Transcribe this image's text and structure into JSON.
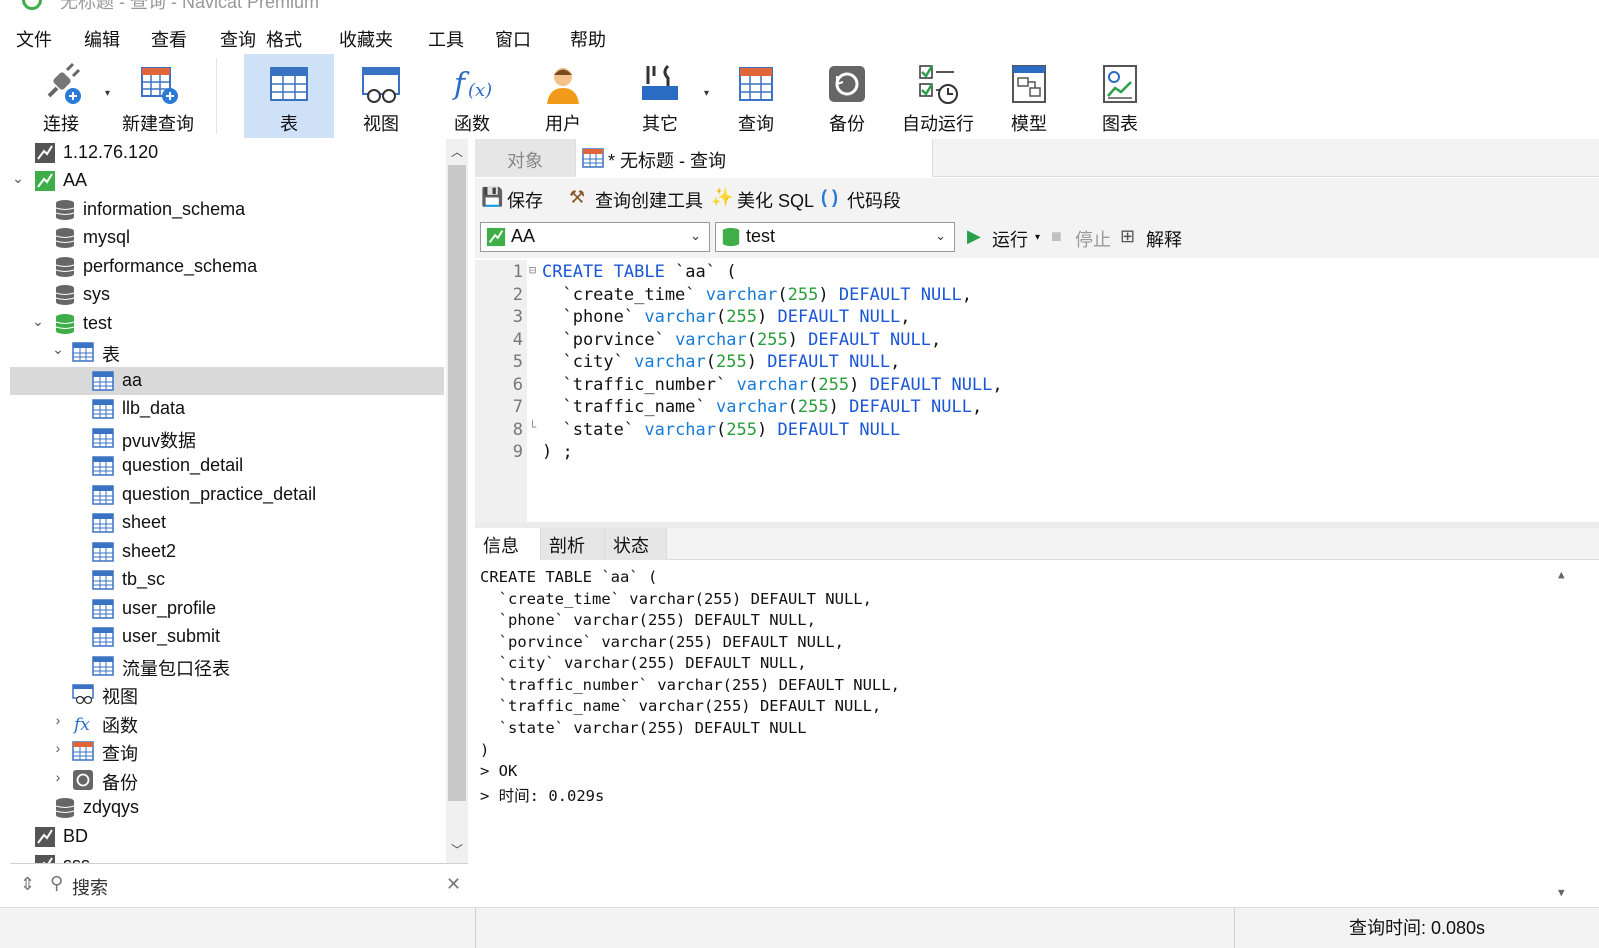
{
  "window": {
    "title": "无标题 - 查询 - Navicat Premium"
  },
  "menu": [
    "文件",
    "编辑",
    "查看",
    "查询",
    "格式",
    "收藏夹",
    "工具",
    "窗口",
    "帮助"
  ],
  "toolbar": {
    "connect": "连接",
    "new_query": "新建查询",
    "table": "表",
    "view": "视图",
    "function": "函数",
    "user": "用户",
    "other": "其它",
    "query": "查询",
    "backup": "备份",
    "automation": "自动运行",
    "model": "模型",
    "chart": "图表"
  },
  "tree": {
    "connection_ip": "1.12.76.120",
    "conn_aa": "AA",
    "databases": [
      "information_schema",
      "mysql",
      "performance_schema",
      "sys"
    ],
    "db_test": "test",
    "tables_folder": "表",
    "tables": [
      "aa",
      "llb_data",
      "pvuv数据",
      "question_detail",
      "question_practice_detail",
      "sheet",
      "sheet2",
      "tb_sc",
      "user_profile",
      "user_submit",
      "流量包口径表"
    ],
    "views_folder": "视图",
    "functions_folder": "函数",
    "queries_folder": "查询",
    "backups_folder": "备份",
    "db_zdyqys": "zdyqys",
    "conn_bd": "BD",
    "conn_partial": "sss"
  },
  "search": {
    "placeholder": "搜索"
  },
  "tabs": {
    "objects": "对象",
    "query_tab": "* 无标题 - 查询"
  },
  "query_toolbar": {
    "save": "保存",
    "builder": "查询创建工具",
    "beautify": "美化 SQL",
    "snippet": "代码段"
  },
  "selectors": {
    "connection": "AA",
    "database": "test",
    "run": "运行",
    "stop": "停止",
    "explain": "解释"
  },
  "editor": {
    "line_numbers": [
      "1",
      "2",
      "3",
      "4",
      "5",
      "6",
      "7",
      "8",
      "9"
    ]
  },
  "result_tabs": {
    "info": "信息",
    "profile": "剖析",
    "status": "状态"
  },
  "output_lines": [
    "CREATE TABLE `aa` (",
    "  `create_time` varchar(255) DEFAULT NULL,",
    "  `phone` varchar(255) DEFAULT NULL,",
    "  `porvince` varchar(255) DEFAULT NULL,",
    "  `city` varchar(255) DEFAULT NULL,",
    "  `traffic_number` varchar(255) DEFAULT NULL,",
    "  `traffic_name` varchar(255) DEFAULT NULL,",
    "  `state` varchar(255) DEFAULT NULL",
    ")",
    "> OK",
    "> 时间: 0.029s"
  ],
  "status": {
    "query_time": "查询时间: 0.080s"
  },
  "colors": {
    "accent": "#1a56d6",
    "number": "#2a9d3a",
    "selected_tool": "#cfe1f7",
    "db_green": "#3fae49"
  }
}
